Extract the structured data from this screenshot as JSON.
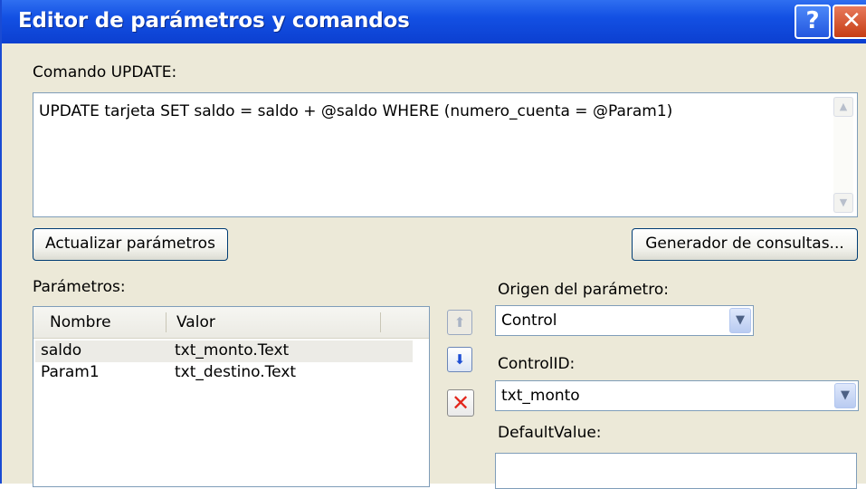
{
  "window": {
    "title": "Editor de parámetros y comandos",
    "help_label": "?",
    "close_label": "✕"
  },
  "command": {
    "label": "Comando UPDATE:",
    "text": "UPDATE tarjeta SET saldo = saldo + @saldo WHERE (numero_cuenta = @Param1)"
  },
  "buttons": {
    "refresh_label": "Actualizar parámetros",
    "query_builder_label": "Generador de consultas..."
  },
  "parameters": {
    "label": "Parámetros:",
    "columns": [
      "Nombre",
      "Valor"
    ],
    "rows": [
      {
        "name": "saldo",
        "value": "txt_monto.Text"
      },
      {
        "name": "Param1",
        "value": "txt_destino.Text"
      }
    ]
  },
  "param_source": {
    "label": "Origen del parámetro:",
    "selected": "Control"
  },
  "control_id": {
    "label": "ControlID:",
    "selected": "txt_monto"
  },
  "default_value": {
    "label": "DefaultValue:",
    "value": ""
  },
  "icons": {
    "scroll_up": "scroll-up-arrow-icon",
    "scroll_down": "scroll-down-arrow-icon",
    "move_up": "arrow-up-icon",
    "move_down": "arrow-down-icon",
    "delete": "red-x-delete-icon",
    "dropdown": "chevron-down-icon"
  },
  "colors": {
    "titlebar": "#0c3fd0",
    "dialog_bg": "#ece9d8",
    "delete_red": "#e3261c",
    "arrow_blue": "#1e4fd4"
  }
}
